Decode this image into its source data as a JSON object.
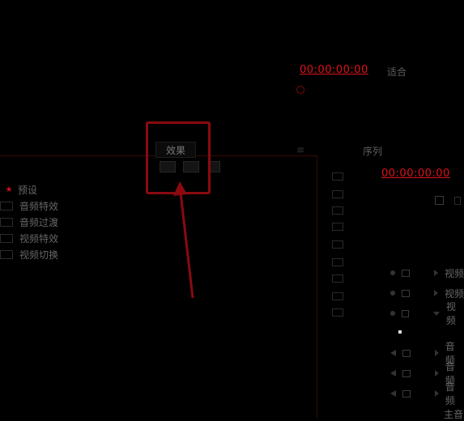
{
  "source_monitor": {
    "timecode": "00:00:00:00",
    "fit_label": "适合"
  },
  "effects_panel": {
    "tab_label": "效果",
    "tree": [
      {
        "label": "预设",
        "starred": true
      },
      {
        "label": "音频特效",
        "starred": false
      },
      {
        "label": "音频过渡",
        "starred": false
      },
      {
        "label": "视频特效",
        "starred": false
      },
      {
        "label": "视频切换",
        "starred": false
      }
    ]
  },
  "timeline": {
    "tab_label": "序列",
    "timecode": "00:00:00:00",
    "tracks": [
      {
        "label": "视频",
        "type": "video",
        "expanded": false
      },
      {
        "label": "视频",
        "type": "video",
        "expanded": false
      },
      {
        "label": "视频",
        "type": "video",
        "expanded": true
      },
      {
        "label": "音频",
        "type": "audio",
        "expanded": false
      },
      {
        "label": "音频",
        "type": "audio",
        "expanded": false
      },
      {
        "label": "音频",
        "type": "audio",
        "expanded": false
      },
      {
        "label": "主音",
        "type": "master",
        "expanded": false
      }
    ]
  },
  "colors": {
    "timecode": "#e0101a",
    "highlight": "#8a0a10",
    "arrow": "#8a0a10"
  }
}
